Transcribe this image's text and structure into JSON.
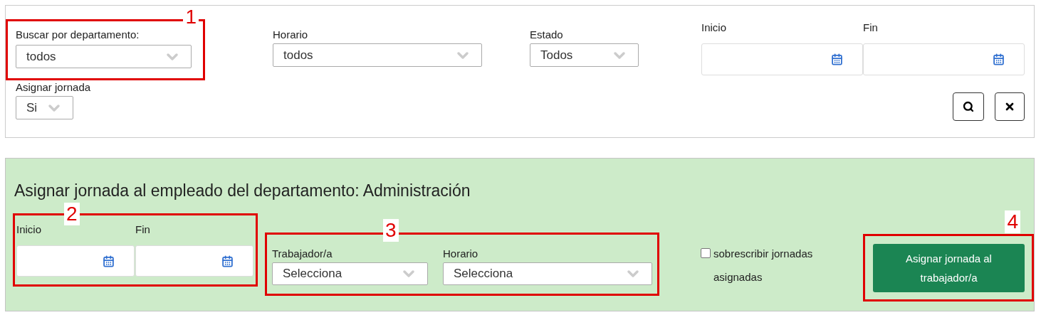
{
  "filter_panel": {
    "department": {
      "label": "Buscar por departamento:",
      "value": "todos",
      "callout": "1"
    },
    "horario": {
      "label": "Horario",
      "value": "todos"
    },
    "estado": {
      "label": "Estado",
      "value": "Todos"
    },
    "inicio": {
      "label": "Inicio"
    },
    "fin": {
      "label": "Fin"
    },
    "asignar_jornada": {
      "label": "Asignar jornada",
      "value": "Si"
    }
  },
  "assign_panel": {
    "title": "Asignar jornada al empleado del departamento: Administración",
    "dates": {
      "callout": "2",
      "inicio": {
        "label": "Inicio"
      },
      "fin": {
        "label": "Fin"
      }
    },
    "selects": {
      "callout": "3",
      "trabajador": {
        "label": "Trabajador/a",
        "value": "Selecciona"
      },
      "horario": {
        "label": "Horario",
        "value": "Selecciona"
      }
    },
    "overwrite": {
      "label": "sobrescribir jornadas asignadas",
      "checked": false
    },
    "submit": {
      "callout": "4",
      "label": "Asignar jornada al trabajador/a"
    }
  }
}
